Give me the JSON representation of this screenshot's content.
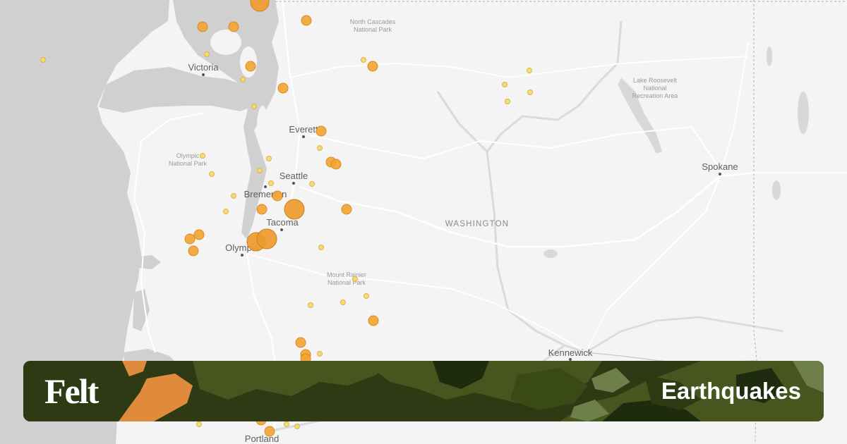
{
  "map": {
    "region_label": "WASHINGTON",
    "cities": [
      {
        "name": "Victoria"
      },
      {
        "name": "Everett"
      },
      {
        "name": "Seattle"
      },
      {
        "name": "Bremerton"
      },
      {
        "name": "Tacoma"
      },
      {
        "name": "Olympia"
      },
      {
        "name": "Spokane"
      },
      {
        "name": "Kennewick"
      },
      {
        "name": "Portland"
      }
    ],
    "parks": [
      {
        "lines": [
          "North Cascades",
          "National Park"
        ]
      },
      {
        "lines": [
          "Olympic",
          "National Park"
        ]
      },
      {
        "lines": [
          "Mount Rainier",
          "National Park"
        ]
      },
      {
        "lines": [
          "Lake Roosevelt",
          "National",
          "Recreation Area"
        ]
      }
    ],
    "colors": {
      "quake_fill": "#f2a534",
      "quake_small_fill": "#f6d86a",
      "land": "#f4f4f4",
      "water": "#d0d0d0"
    }
  },
  "banner": {
    "logo": "Felt",
    "title": "Earthquakes",
    "colors": {
      "bg": "#2d3a14",
      "camo_dark": "#1f2b0e",
      "camo_mid": "#46561e",
      "camo_light": "#6f7f4c",
      "orange": "#e08a3c"
    }
  }
}
